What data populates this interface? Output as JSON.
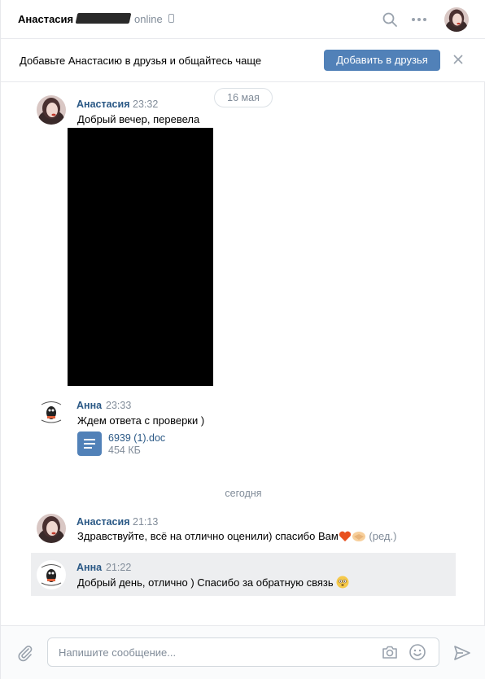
{
  "header": {
    "contact_name": "Анастасия",
    "status": "online",
    "icons": [
      "search-icon",
      "more-icon",
      "mobile-icon"
    ]
  },
  "friend_bar": {
    "text": "Добавьте Анастасию в друзья и общайтесь чаще",
    "add_button": "Добавить в друзья",
    "close_icon": "close-icon"
  },
  "messages": {
    "date_1": "16 мая",
    "msg1": {
      "author": "Анастасия",
      "time": "23:32",
      "text": "Добрый вечер, перевела"
    },
    "msg2": {
      "author": "Анна",
      "time": "23:33",
      "text": "Ждем ответа с проверки )",
      "doc": {
        "name": "6939 (1).doc",
        "size": "454 КБ"
      }
    },
    "date_2": "сегодня",
    "msg3": {
      "author": "Анастасия",
      "time": "21:13",
      "text": "Здравствуйте, всё на отлично оценили) спасибо Вам",
      "edited": "(ред.)"
    },
    "msg4": {
      "author": "Анна",
      "time": "21:22",
      "text": "Добрый день, отлично ) Спасибо за обратную связь"
    }
  },
  "composer": {
    "placeholder": "Напишите сообщение...",
    "icons": [
      "attach-icon",
      "camera-icon",
      "smile-icon",
      "send-icon"
    ]
  },
  "colors": {
    "accent": "#5181b8",
    "link": "#2a5885",
    "muted": "#818c99",
    "highlight": "#edeef0"
  }
}
